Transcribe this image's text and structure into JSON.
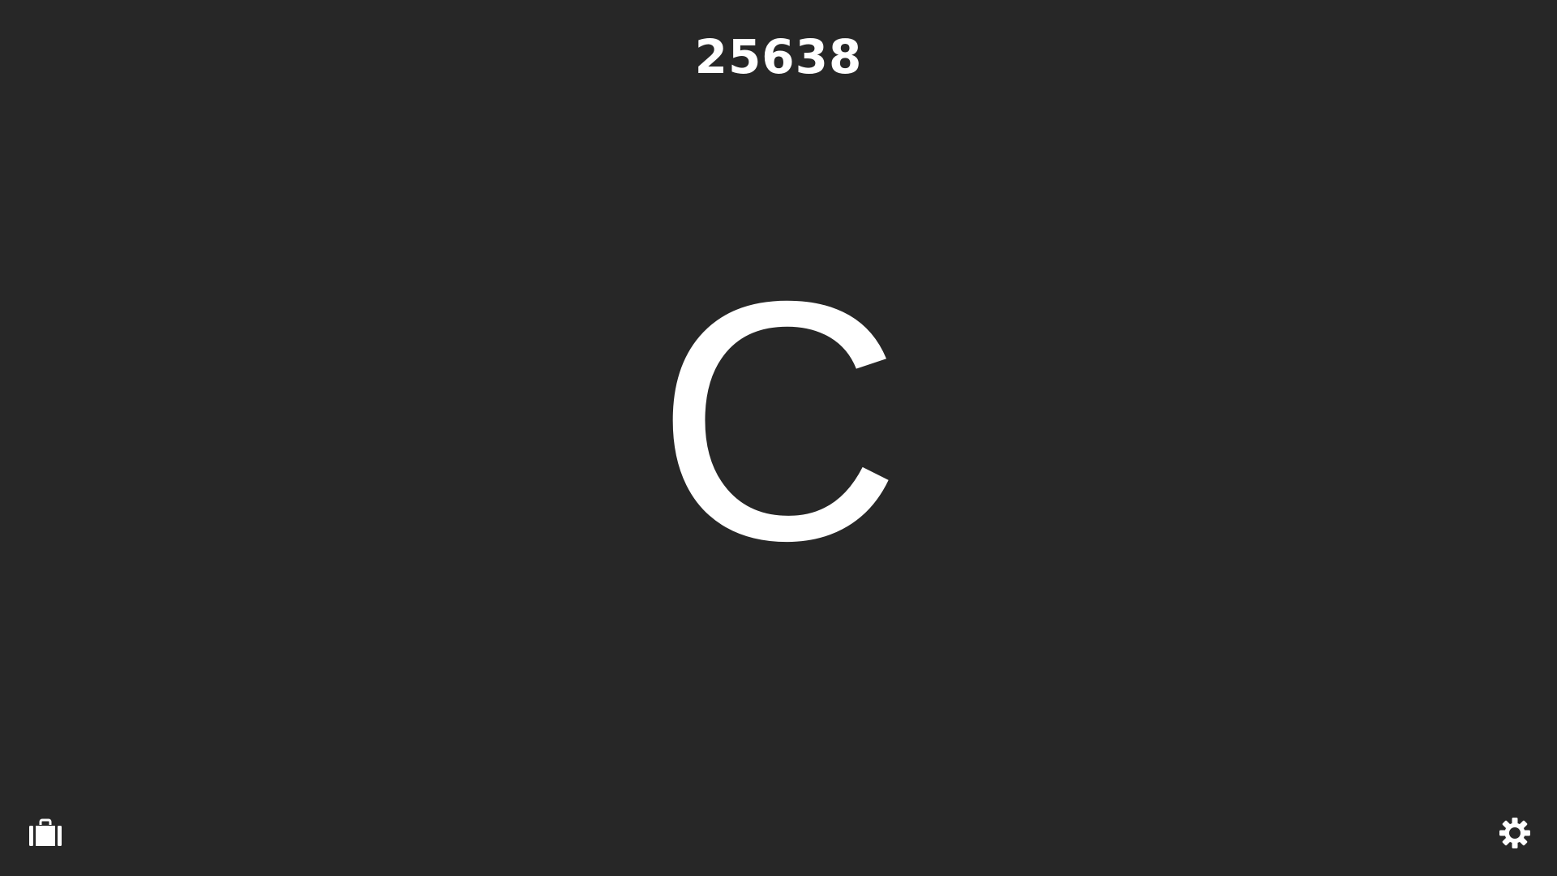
{
  "score": "25638",
  "current_letter": "C",
  "controls": {
    "inventory_icon": "briefcase-icon",
    "settings_icon": "gear-icon"
  },
  "colors": {
    "background": "#272727",
    "foreground": "#ffffff"
  }
}
